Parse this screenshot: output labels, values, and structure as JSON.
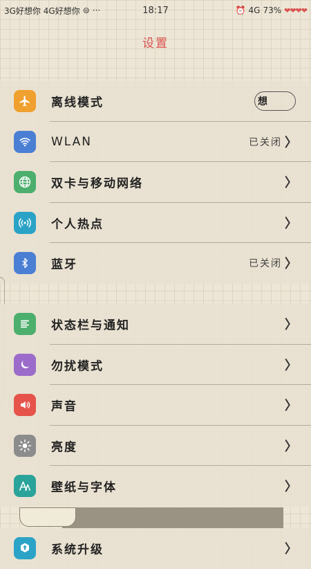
{
  "status_bar": {
    "left_text": "3G好想你 4G好想你",
    "time": "18:17",
    "network": "4G",
    "battery": "73%",
    "dots": "···"
  },
  "title": "设置",
  "groups": [
    {
      "items": [
        {
          "label": "离线模式",
          "icon": "airplane-icon",
          "color": "#f0a02e",
          "toggle_text": "想"
        },
        {
          "label": "WLAN",
          "icon": "wifi-icon",
          "color": "#4a7fd4",
          "value": "已关闭"
        },
        {
          "label": "双卡与移动网络",
          "icon": "globe-icon",
          "color": "#4caf6d"
        },
        {
          "label": "个人热点",
          "icon": "hotspot-icon",
          "color": "#2aa3c7"
        },
        {
          "label": "蓝牙",
          "icon": "bluetooth-icon",
          "color": "#4a7fd4",
          "value": "已关闭"
        }
      ]
    },
    {
      "items": [
        {
          "label": "状态栏与通知",
          "icon": "notification-icon",
          "color": "#4caf6d"
        },
        {
          "label": "勿扰模式",
          "icon": "moon-icon",
          "color": "#9b6cc9"
        },
        {
          "label": "声音",
          "icon": "speaker-icon",
          "color": "#e5534b"
        },
        {
          "label": "亮度",
          "icon": "sun-icon",
          "color": "#8c8c8c"
        },
        {
          "label": "壁纸与字体",
          "icon": "wallpaper-icon",
          "color": "#2aa39a"
        }
      ]
    },
    {
      "items": [
        {
          "label": "系统升级",
          "icon": "upgrade-icon",
          "color": "#2aa3c7"
        }
      ]
    }
  ]
}
